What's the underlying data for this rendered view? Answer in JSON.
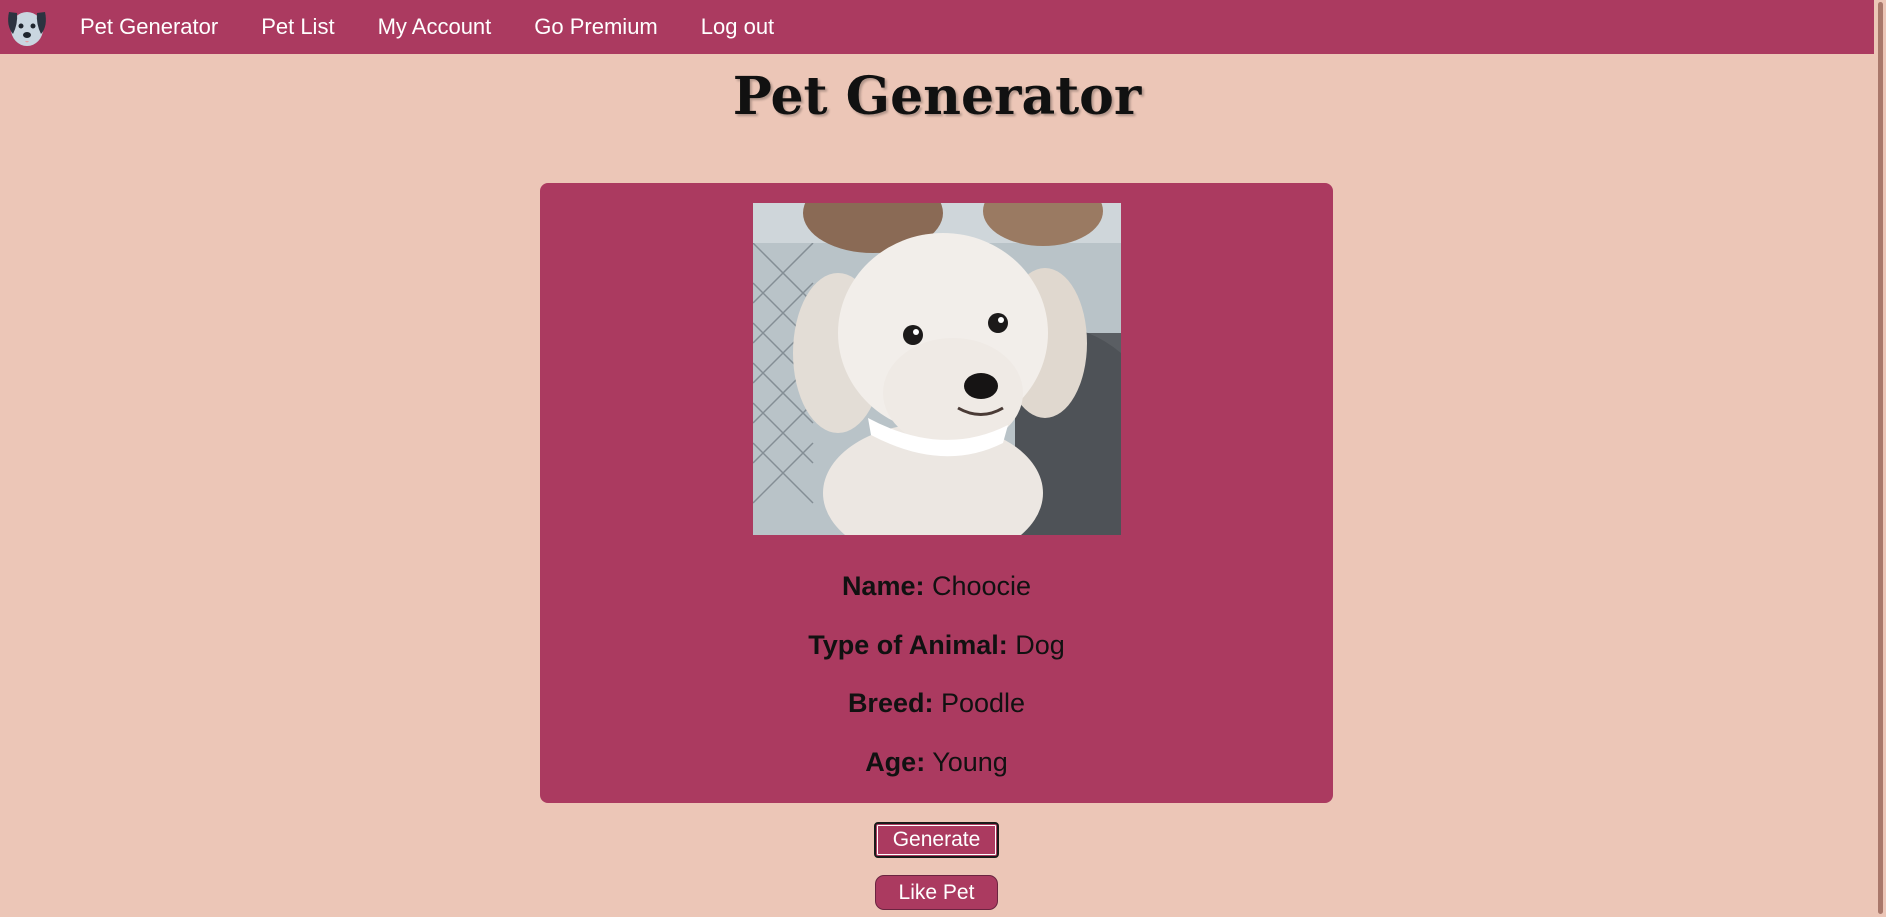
{
  "nav": {
    "logo_icon": "dog-face-icon",
    "items": [
      {
        "label": "Pet Generator"
      },
      {
        "label": "Pet List"
      },
      {
        "label": "My Account"
      },
      {
        "label": "Go Premium"
      },
      {
        "label": "Log out"
      }
    ]
  },
  "page": {
    "title": "Pet Generator"
  },
  "pet": {
    "photo_subject": "white-dog-photo",
    "fields": [
      {
        "label": "Name:",
        "value": "Choocie"
      },
      {
        "label": "Type of Animal:",
        "value": "Dog"
      },
      {
        "label": "Breed:",
        "value": "Poodle"
      },
      {
        "label": "Age:",
        "value": "Young"
      }
    ]
  },
  "actions": {
    "generate_label": "Generate",
    "like_label": "Like Pet"
  },
  "colors": {
    "accent": "#ab3a60",
    "background": "#ecc6b7"
  }
}
